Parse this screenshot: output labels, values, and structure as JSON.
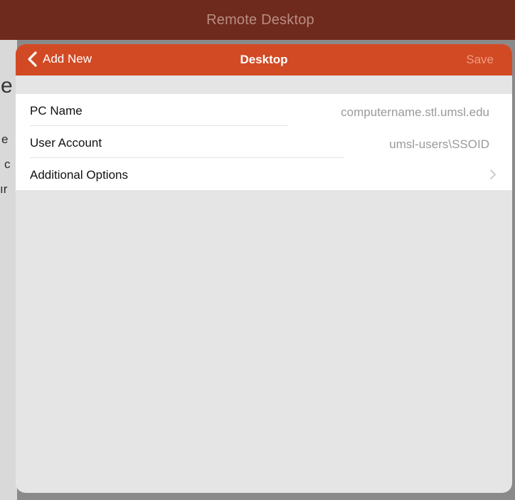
{
  "app": {
    "title": "Remote Desktop",
    "background_fragments": [
      "e",
      "e",
      "c",
      "ır"
    ]
  },
  "sheet": {
    "nav": {
      "back_label": "Add New",
      "title": "Desktop",
      "save_label": "Save"
    },
    "rows": [
      {
        "label": "PC Name",
        "value": "computername.stl.umsl.edu"
      },
      {
        "label": "User Account",
        "value": "umsl-users\\SSOID"
      },
      {
        "label": "Additional Options"
      }
    ]
  },
  "colors": {
    "nav_bar": "#d24a24",
    "app_header": "#6e2a1c",
    "save_disabled": "#ef9c83",
    "placeholder_text": "#9a9a9a"
  },
  "icons": [
    "chevron-left-icon",
    "chevron-right-icon"
  ]
}
